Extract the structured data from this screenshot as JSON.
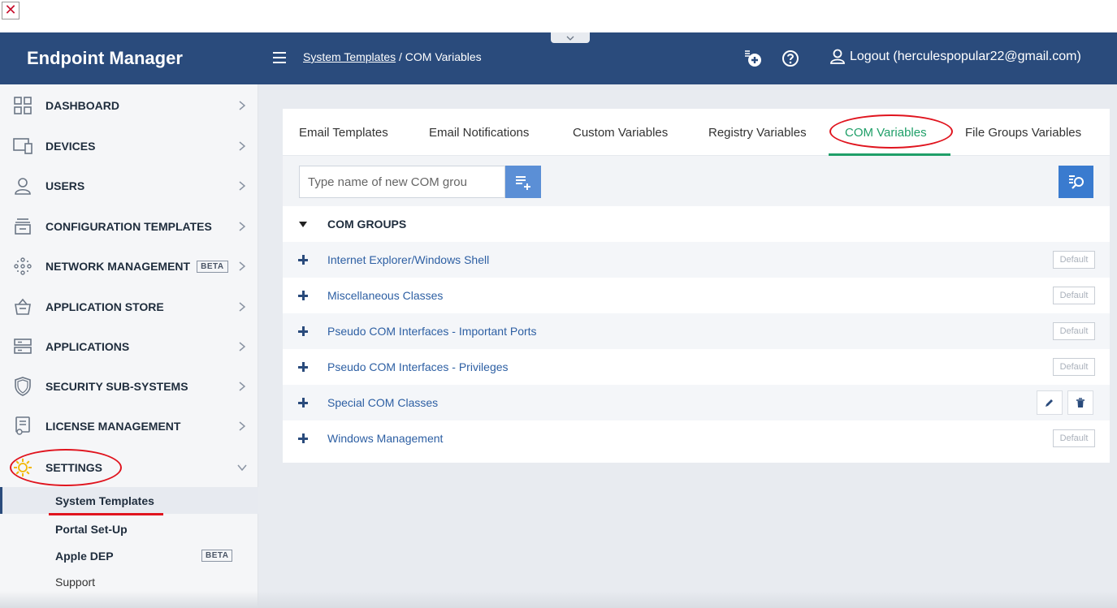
{
  "app": {
    "title": "Endpoint Manager"
  },
  "topbar": {
    "breadcrumb_parent": "System Templates",
    "breadcrumb_sep": " / ",
    "breadcrumb_current": "COM Variables",
    "logout_label": "Logout (herculespopular22@gmail.com)"
  },
  "sidebar": {
    "items": [
      {
        "label": "DASHBOARD",
        "icon": "dashboard-icon"
      },
      {
        "label": "DEVICES",
        "icon": "devices-icon"
      },
      {
        "label": "USERS",
        "icon": "user-icon"
      },
      {
        "label": "CONFIGURATION TEMPLATES",
        "icon": "templates-icon"
      },
      {
        "label": "NETWORK MANAGEMENT",
        "icon": "network-icon",
        "badge": "BETA"
      },
      {
        "label": "APPLICATION STORE",
        "icon": "store-icon"
      },
      {
        "label": "APPLICATIONS",
        "icon": "applications-icon"
      },
      {
        "label": "SECURITY SUB-SYSTEMS",
        "icon": "shield-icon"
      },
      {
        "label": "LICENSE MANAGEMENT",
        "icon": "license-icon"
      },
      {
        "label": "SETTINGS",
        "icon": "gear-icon"
      }
    ],
    "sub_items": [
      {
        "label": "System Templates"
      },
      {
        "label": "Portal Set-Up"
      },
      {
        "label": "Apple DEP",
        "badge": "BETA"
      },
      {
        "label": "Support"
      }
    ]
  },
  "tabs": [
    {
      "label": "Email Templates"
    },
    {
      "label": "Email Notifications"
    },
    {
      "label": "Custom Variables"
    },
    {
      "label": "Registry Variables"
    },
    {
      "label": "COM Variables"
    },
    {
      "label": "File Groups Variables"
    }
  ],
  "toolbar": {
    "input_placeholder": "Type name of new COM grou"
  },
  "groups": {
    "header": "COM GROUPS",
    "default_label": "Default",
    "rows": [
      {
        "name": "Internet Explorer/Windows Shell"
      },
      {
        "name": "Miscellaneous Classes"
      },
      {
        "name": "Pseudo COM Interfaces - Important Ports"
      },
      {
        "name": "Pseudo COM Interfaces - Privileges"
      },
      {
        "name": "Special COM Classes"
      },
      {
        "name": "Windows Management"
      }
    ]
  },
  "colors": {
    "header_bg": "#2a4b7c",
    "active_tab": "#1f9f68",
    "link": "#2d5fa3",
    "annotation": "#e0141e",
    "settings_icon": "#f2b705"
  }
}
